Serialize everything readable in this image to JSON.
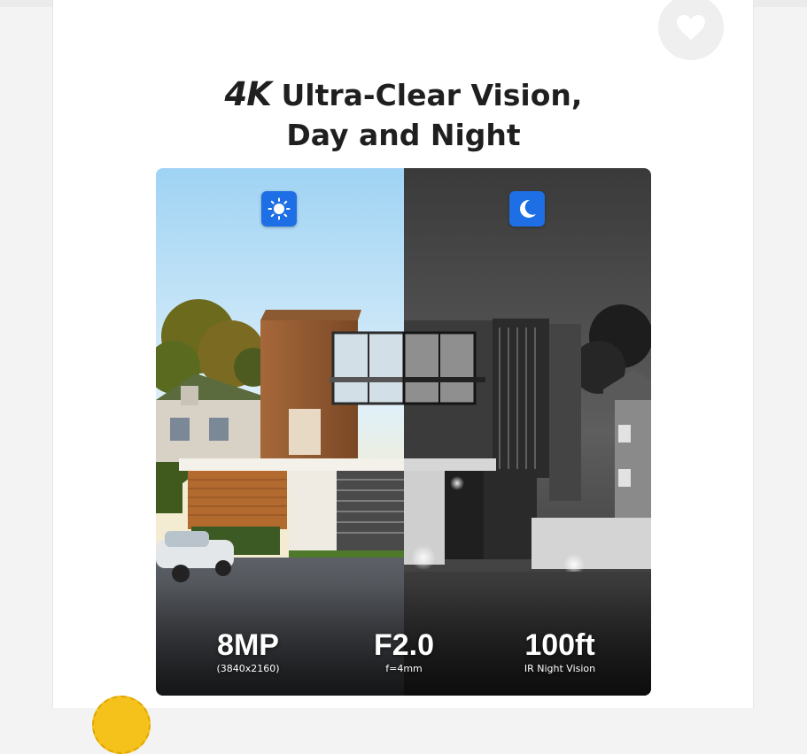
{
  "title": {
    "line1_accent": "4K",
    "line1_rest": " Ultra-Clear Vision,",
    "line2": "Day and Night"
  },
  "icons": {
    "favorite": "heart-icon",
    "day": "sun-icon",
    "night": "moon-icon",
    "seal": "award-seal"
  },
  "colors": {
    "badge": "#1e6fe6",
    "title": "#1f1f1f",
    "card": "#ffffff",
    "background": "#f3f3f3"
  },
  "stats": [
    {
      "value": "8MP",
      "sub": "(3840x2160)"
    },
    {
      "value": "F2.0",
      "sub": "f=4mm"
    },
    {
      "value": "100ft",
      "sub": "IR Night Vision"
    }
  ]
}
